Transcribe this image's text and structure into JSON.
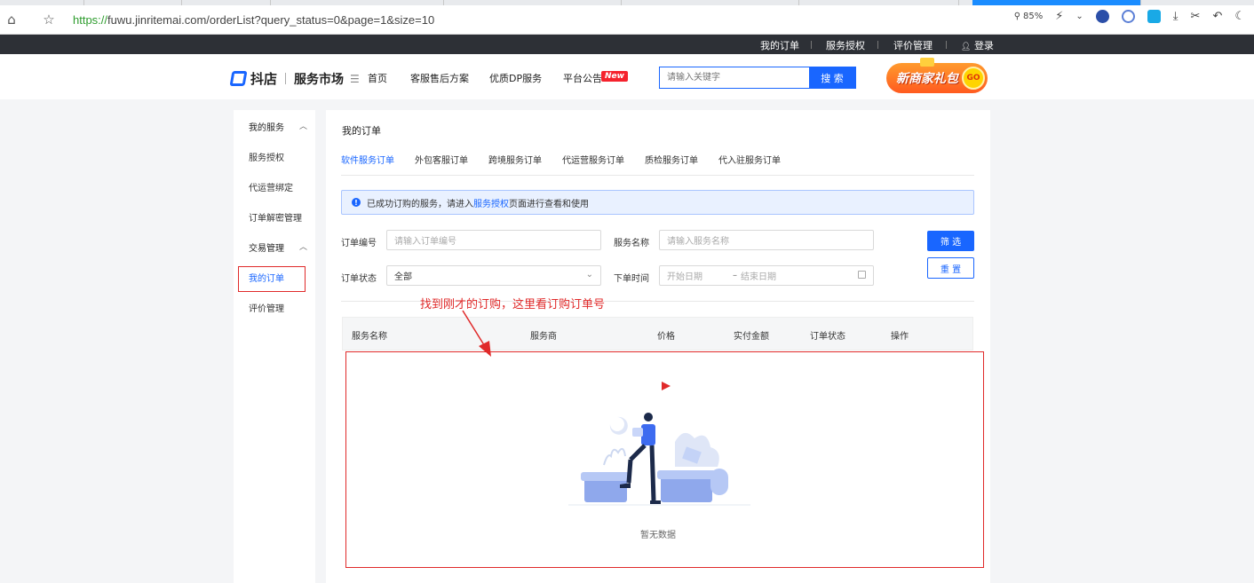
{
  "browser": {
    "url_scheme": "https://",
    "url_rest": "fuwu.jinritemai.com/orderList?query_status=0&page=1&size=10",
    "zoom": "85%"
  },
  "topbar": {
    "my_orders": "我的订单",
    "service_auth": "服务授权",
    "reviews": "评价管理",
    "login": "登录"
  },
  "header": {
    "logo_text": "抖店",
    "logo_sub": "服务市场",
    "nav": [
      "首页",
      "客服售后方案",
      "优质DP服务",
      "平台公告"
    ],
    "new_badge": "New",
    "search_placeholder": "请输入关键字",
    "search_button": "搜 索",
    "gift_text": "新商家礼包",
    "gift_go": "GO"
  },
  "sidebar": {
    "group1": "我的服务",
    "items1": [
      "服务授权",
      "代运营绑定",
      "订单解密管理"
    ],
    "group2": "交易管理",
    "items2": [
      "我的订单",
      "评价管理"
    ]
  },
  "content": {
    "title": "我的订单",
    "tabs": [
      "软件服务订单",
      "外包客服订单",
      "跨境服务订单",
      "代运营服务订单",
      "质检服务订单",
      "代入驻服务订单"
    ],
    "notice_pre": "已成功订购的服务，请进入",
    "notice_link": "服务授权",
    "notice_post": "页面进行查看和使用",
    "filters": {
      "order_no_label": "订单编号",
      "order_no_placeholder": "请输入订单编号",
      "service_name_label": "服务名称",
      "service_name_placeholder": "请输入服务名称",
      "status_label": "订单状态",
      "status_value": "全部",
      "time_label": "下单时间",
      "start_placeholder": "开始日期",
      "range_sep": "–",
      "end_placeholder": "结束日期"
    },
    "filter_button": "筛 选",
    "reset_button": "重 置",
    "columns": [
      "服务名称",
      "服务商",
      "价格",
      "实付金额",
      "订单状态",
      "操作"
    ],
    "empty": "暂无数据"
  },
  "annotation": {
    "text": "找到刚才的订购，这里看订购订单号"
  },
  "colors": {
    "primary": "#1966ff",
    "annotation_red": "#e02a2a",
    "topbar_bg": "#2d3036"
  }
}
